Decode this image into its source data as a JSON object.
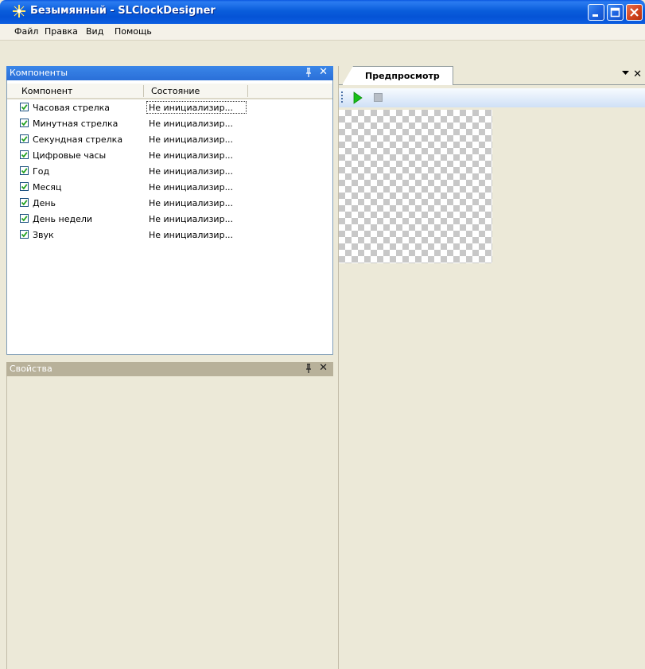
{
  "window": {
    "title": "Безымянный - SLClockDesigner"
  },
  "menu": [
    {
      "label": "Файл"
    },
    {
      "label": "Правка"
    },
    {
      "label": "Вид"
    },
    {
      "label": "Помощь"
    }
  ],
  "components_panel": {
    "title": "Компоненты",
    "columns": [
      "Компонент",
      "Состояние"
    ],
    "rows": [
      {
        "name": "Часовая стрелка",
        "state": "Не инициализир...",
        "checked": true
      },
      {
        "name": "Минутная стрелка",
        "state": "Не инициализир...",
        "checked": true
      },
      {
        "name": "Секундная стрелка",
        "state": "Не инициализир...",
        "checked": true
      },
      {
        "name": "Цифровые часы",
        "state": "Не инициализир...",
        "checked": true
      },
      {
        "name": "Год",
        "state": "Не инициализир...",
        "checked": true
      },
      {
        "name": "Месяц",
        "state": "Не инициализир...",
        "checked": true
      },
      {
        "name": "День",
        "state": "Не инициализир...",
        "checked": true
      },
      {
        "name": "День недели",
        "state": "Не инициализир...",
        "checked": true
      },
      {
        "name": "Звук",
        "state": "Не инициализир...",
        "checked": true
      }
    ]
  },
  "properties_panel": {
    "title": "Свойства"
  },
  "preview": {
    "tab_label": "Предпросмотр"
  },
  "colors": {
    "titlebar": "#0553d6",
    "panel_header_active": "#2a6fd8",
    "panel_header_inactive": "#b8b19a",
    "checkmark": "#21a121",
    "play": "#18c018"
  }
}
